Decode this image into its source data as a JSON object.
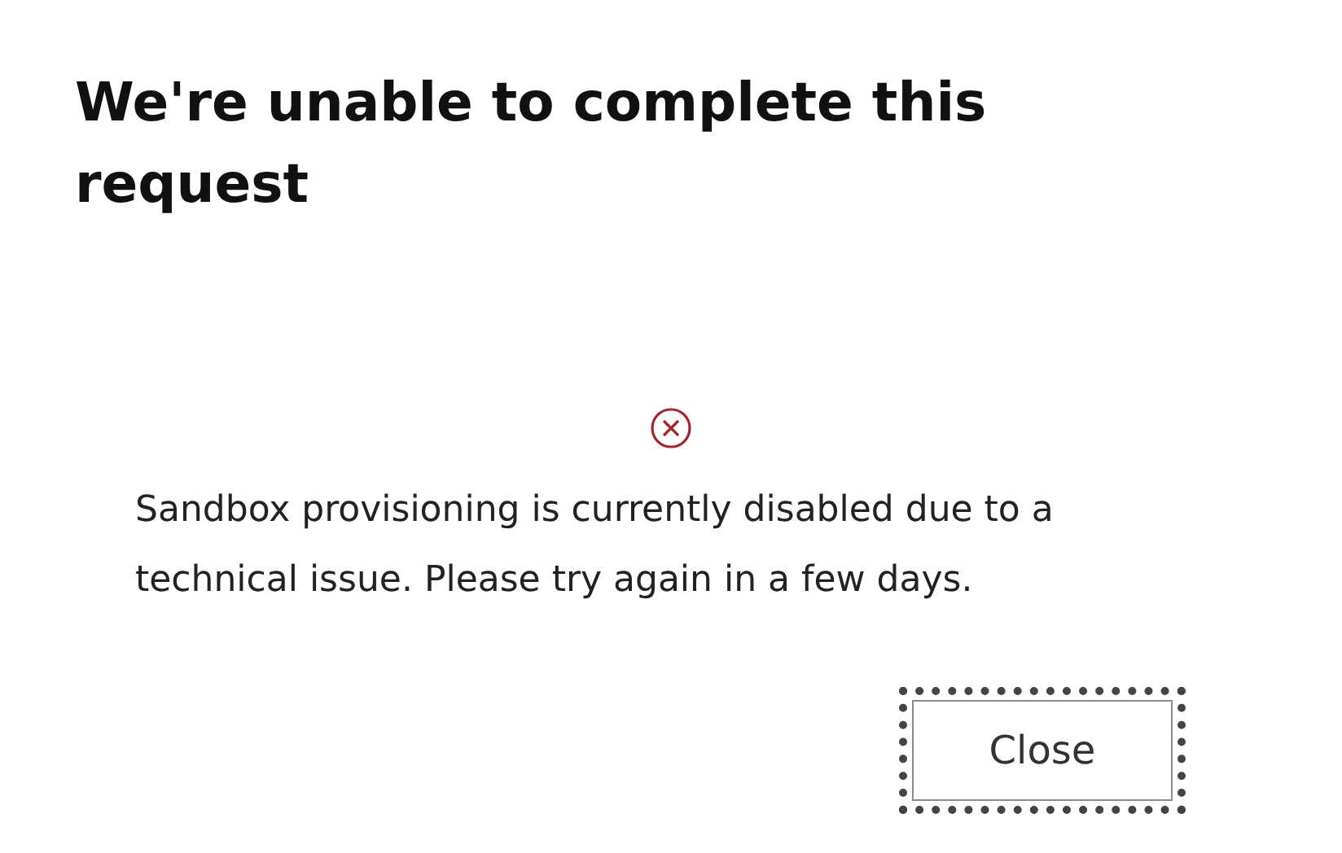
{
  "dialog": {
    "title": "We're unable to complete this request",
    "message": "Sandbox provisioning is currently disabled due to a technical issue. Please try again in a few days.",
    "buttons": [
      {
        "label": "Close",
        "focused": true
      }
    ]
  }
}
